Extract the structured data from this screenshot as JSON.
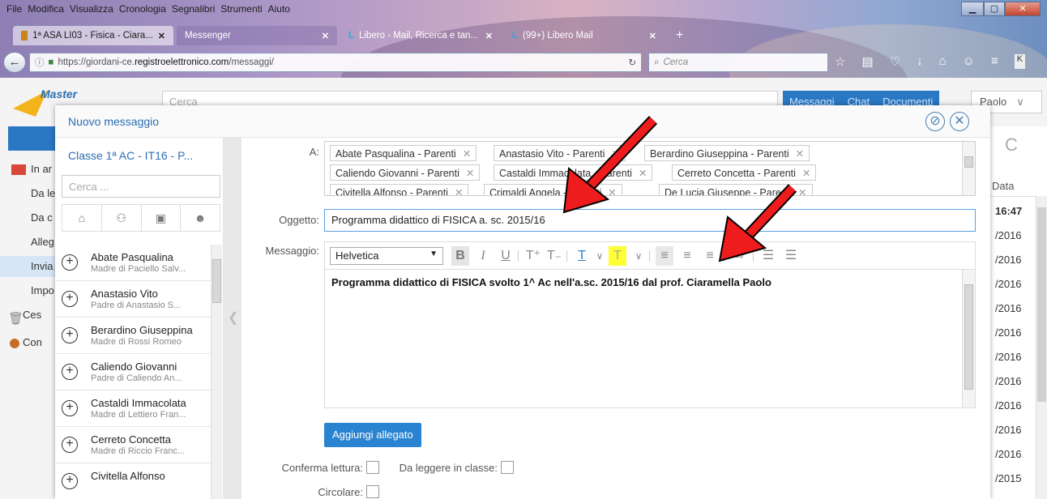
{
  "browser": {
    "menu": [
      "File",
      "Modifica",
      "Visualizza",
      "Cronologia",
      "Segnalibri",
      "Strumenti",
      "Aiuto"
    ],
    "tabs": [
      {
        "label": "1ª ASA LI03 - Fisica - Ciara..."
      },
      {
        "label": "Messenger"
      },
      {
        "label": "Libero - Mail, Ricerca e tan..."
      },
      {
        "label": "(99+) Libero Mail"
      }
    ],
    "url_prefix": "https://giordani-ce.",
    "url_domain": "registroelettronico.com",
    "url_suffix": "/messaggi/",
    "search_placeholder": "Cerca"
  },
  "app": {
    "logo_text": "Master",
    "search_placeholder": "Cerca",
    "top_buttons": [
      "Messaggi",
      "Chat",
      "Documenti"
    ],
    "user": "Paolo",
    "leftnav": [
      "In ar",
      "Da le",
      "Da c",
      "Alleg",
      "Invia",
      "Impo",
      "Ces",
      "Con"
    ],
    "column_header": "Data",
    "dates": [
      "16:47",
      "/2016",
      "/2016",
      "/2016",
      "/2016",
      "/2016",
      "/2016",
      "/2016",
      "/2016",
      "/2016",
      "/2016",
      "/2015"
    ]
  },
  "modal": {
    "title": "Nuovo messaggio",
    "class_title": "Classe 1ª AC - IT16 - P...",
    "left_search_placeholder": "Cerca ...",
    "contacts": [
      {
        "name": "Abate Pasqualina",
        "sub": "Madre di Paciello Salv..."
      },
      {
        "name": "Anastasio Vito",
        "sub": "Padre di Anastasio S..."
      },
      {
        "name": "Berardino Giuseppina",
        "sub": "Madre di Rossi Romeo"
      },
      {
        "name": "Caliendo Giovanni",
        "sub": "Padre di Caliendo An..."
      },
      {
        "name": "Castaldi Immacolata",
        "sub": "Madre di Lettiero Fran..."
      },
      {
        "name": "Cerreto Concetta",
        "sub": "Madre di Riccio Franc..."
      },
      {
        "name": "Civitella Alfonso",
        "sub": ""
      }
    ],
    "label_to": "A:",
    "recipients": [
      "Abate Pasqualina - Parenti",
      "Anastasio Vito - Parenti",
      "Berardino Giuseppina - Parenti",
      "Caliendo Giovanni - Parenti",
      "Castaldi Immacolata - Parenti",
      "Cerreto Concetta - Parenti",
      "Civitella Alfonso - Parenti",
      "Crimaldi Angela - Parenti",
      "De Lucia Giuseppe - Parenti"
    ],
    "label_subject": "Oggetto:",
    "subject": "Programma didattico di FISICA a. sc. 2015/16",
    "label_message": "Messaggio:",
    "font": "Helvetica",
    "body": "Programma didattico di FISICA svolto 1^ Ac nell'a.sc. 2015/16 dal prof. Ciaramella Paolo",
    "attach_button": "Aggiungi allegato",
    "label_confirm": "Conferma lettura:",
    "label_read_class": "Da leggere in classe:",
    "label_circular": "Circolare:"
  },
  "colors": {
    "accent": "#2a78c3",
    "arrow": "#ee1c1c",
    "highlight": "#ffff33"
  }
}
